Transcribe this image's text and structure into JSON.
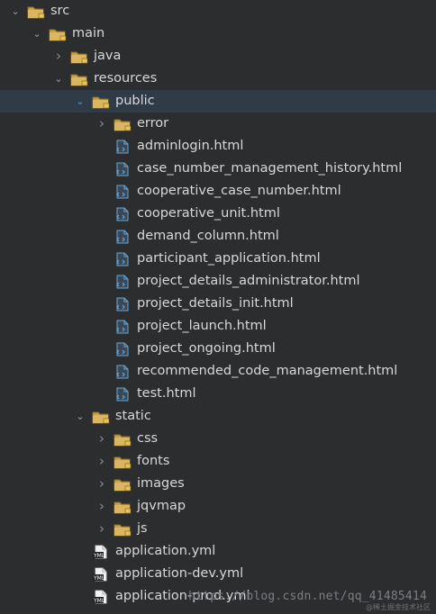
{
  "colors": {
    "background": "#2b2d2f",
    "selected_row": "#2f3b46",
    "folder": "#c9a24a",
    "file_html": "#6aa7d8",
    "file_yml": "#d7d7d7"
  },
  "tree": [
    {
      "label": "src",
      "indent": 0,
      "type": "folder",
      "expand": "open",
      "selected": false
    },
    {
      "label": "main",
      "indent": 1,
      "type": "folder",
      "expand": "open",
      "selected": false
    },
    {
      "label": "java",
      "indent": 2,
      "type": "folder",
      "expand": "closed",
      "selected": false
    },
    {
      "label": "resources",
      "indent": 2,
      "type": "folder",
      "expand": "open",
      "selected": false
    },
    {
      "label": "public",
      "indent": 3,
      "type": "folder",
      "expand": "open",
      "selected": true
    },
    {
      "label": "error",
      "indent": 4,
      "type": "folder",
      "expand": "closed",
      "selected": false
    },
    {
      "label": "adminlogin.html",
      "indent": 4,
      "type": "html",
      "expand": "none",
      "selected": false
    },
    {
      "label": "case_number_management_history.html",
      "indent": 4,
      "type": "html",
      "expand": "none",
      "selected": false
    },
    {
      "label": "cooperative_case_number.html",
      "indent": 4,
      "type": "html",
      "expand": "none",
      "selected": false
    },
    {
      "label": "cooperative_unit.html",
      "indent": 4,
      "type": "html",
      "expand": "none",
      "selected": false
    },
    {
      "label": "demand_column.html",
      "indent": 4,
      "type": "html",
      "expand": "none",
      "selected": false
    },
    {
      "label": "participant_application.html",
      "indent": 4,
      "type": "html",
      "expand": "none",
      "selected": false
    },
    {
      "label": "project_details_administrator.html",
      "indent": 4,
      "type": "html",
      "expand": "none",
      "selected": false
    },
    {
      "label": "project_details_init.html",
      "indent": 4,
      "type": "html",
      "expand": "none",
      "selected": false
    },
    {
      "label": "project_launch.html",
      "indent": 4,
      "type": "html",
      "expand": "none",
      "selected": false
    },
    {
      "label": "project_ongoing.html",
      "indent": 4,
      "type": "html",
      "expand": "none",
      "selected": false
    },
    {
      "label": "recommended_code_management.html",
      "indent": 4,
      "type": "html",
      "expand": "none",
      "selected": false
    },
    {
      "label": "test.html",
      "indent": 4,
      "type": "html",
      "expand": "none",
      "selected": false
    },
    {
      "label": "static",
      "indent": 3,
      "type": "folder",
      "expand": "open",
      "selected": false
    },
    {
      "label": "css",
      "indent": 4,
      "type": "folder",
      "expand": "closed",
      "selected": false
    },
    {
      "label": "fonts",
      "indent": 4,
      "type": "folder",
      "expand": "closed",
      "selected": false
    },
    {
      "label": "images",
      "indent": 4,
      "type": "folder",
      "expand": "closed",
      "selected": false
    },
    {
      "label": "jqvmap",
      "indent": 4,
      "type": "folder",
      "expand": "closed",
      "selected": false
    },
    {
      "label": "js",
      "indent": 4,
      "type": "folder",
      "expand": "closed",
      "selected": false
    },
    {
      "label": "application.yml",
      "indent": 3,
      "type": "yml",
      "expand": "none",
      "selected": false
    },
    {
      "label": "application-dev.yml",
      "indent": 3,
      "type": "yml",
      "expand": "none",
      "selected": false
    },
    {
      "label": "application-prod.yml",
      "indent": 3,
      "type": "yml",
      "expand": "none",
      "selected": false
    }
  ],
  "watermark": {
    "text": "https://blog.csdn.net/qq_41485414",
    "subtext": "@稀土掘金技术社区"
  }
}
